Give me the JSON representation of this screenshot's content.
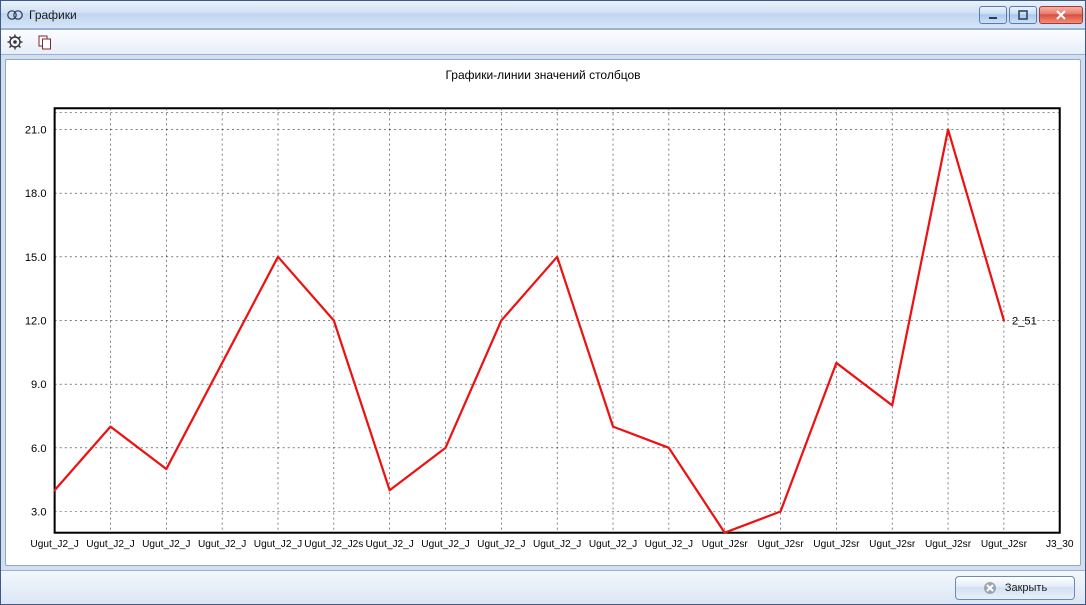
{
  "window": {
    "title": "Графики"
  },
  "chart": {
    "title": "Графики-линии значений столбцов",
    "series_label": "2_51"
  },
  "footer": {
    "close_label": "Закрыть"
  },
  "chart_data": {
    "type": "line",
    "title": "Графики-линии значений столбцов",
    "xlabel": "",
    "ylabel": "",
    "ylim": [
      2,
      22
    ],
    "y_ticks": [
      3.0,
      6.0,
      9.0,
      12.0,
      15.0,
      18.0,
      21.0
    ],
    "categories": [
      "Ugut_J2_J",
      "Ugut_J2_J",
      "Ugut_J2_J",
      "Ugut_J2_J",
      "Ugut_J2_J",
      "Ugut_J2_J2s",
      "Ugut_J2_J",
      "Ugut_J2_J",
      "Ugut_J2_J",
      "Ugut_J2_J",
      "Ugut_J2_J",
      "Ugut_J2_J",
      "Ugut_J2sr",
      "Ugut_J2sr",
      "Ugut_J2sr",
      "Ugut_J2sr",
      "Ugut_J2sr",
      "Ugut_J2sr",
      "J3_30"
    ],
    "series": [
      {
        "name": "2_51",
        "values": [
          4,
          7,
          5,
          10,
          15,
          12,
          4,
          6,
          12,
          15,
          7,
          6,
          2,
          3,
          10,
          8,
          21,
          12
        ]
      }
    ]
  }
}
